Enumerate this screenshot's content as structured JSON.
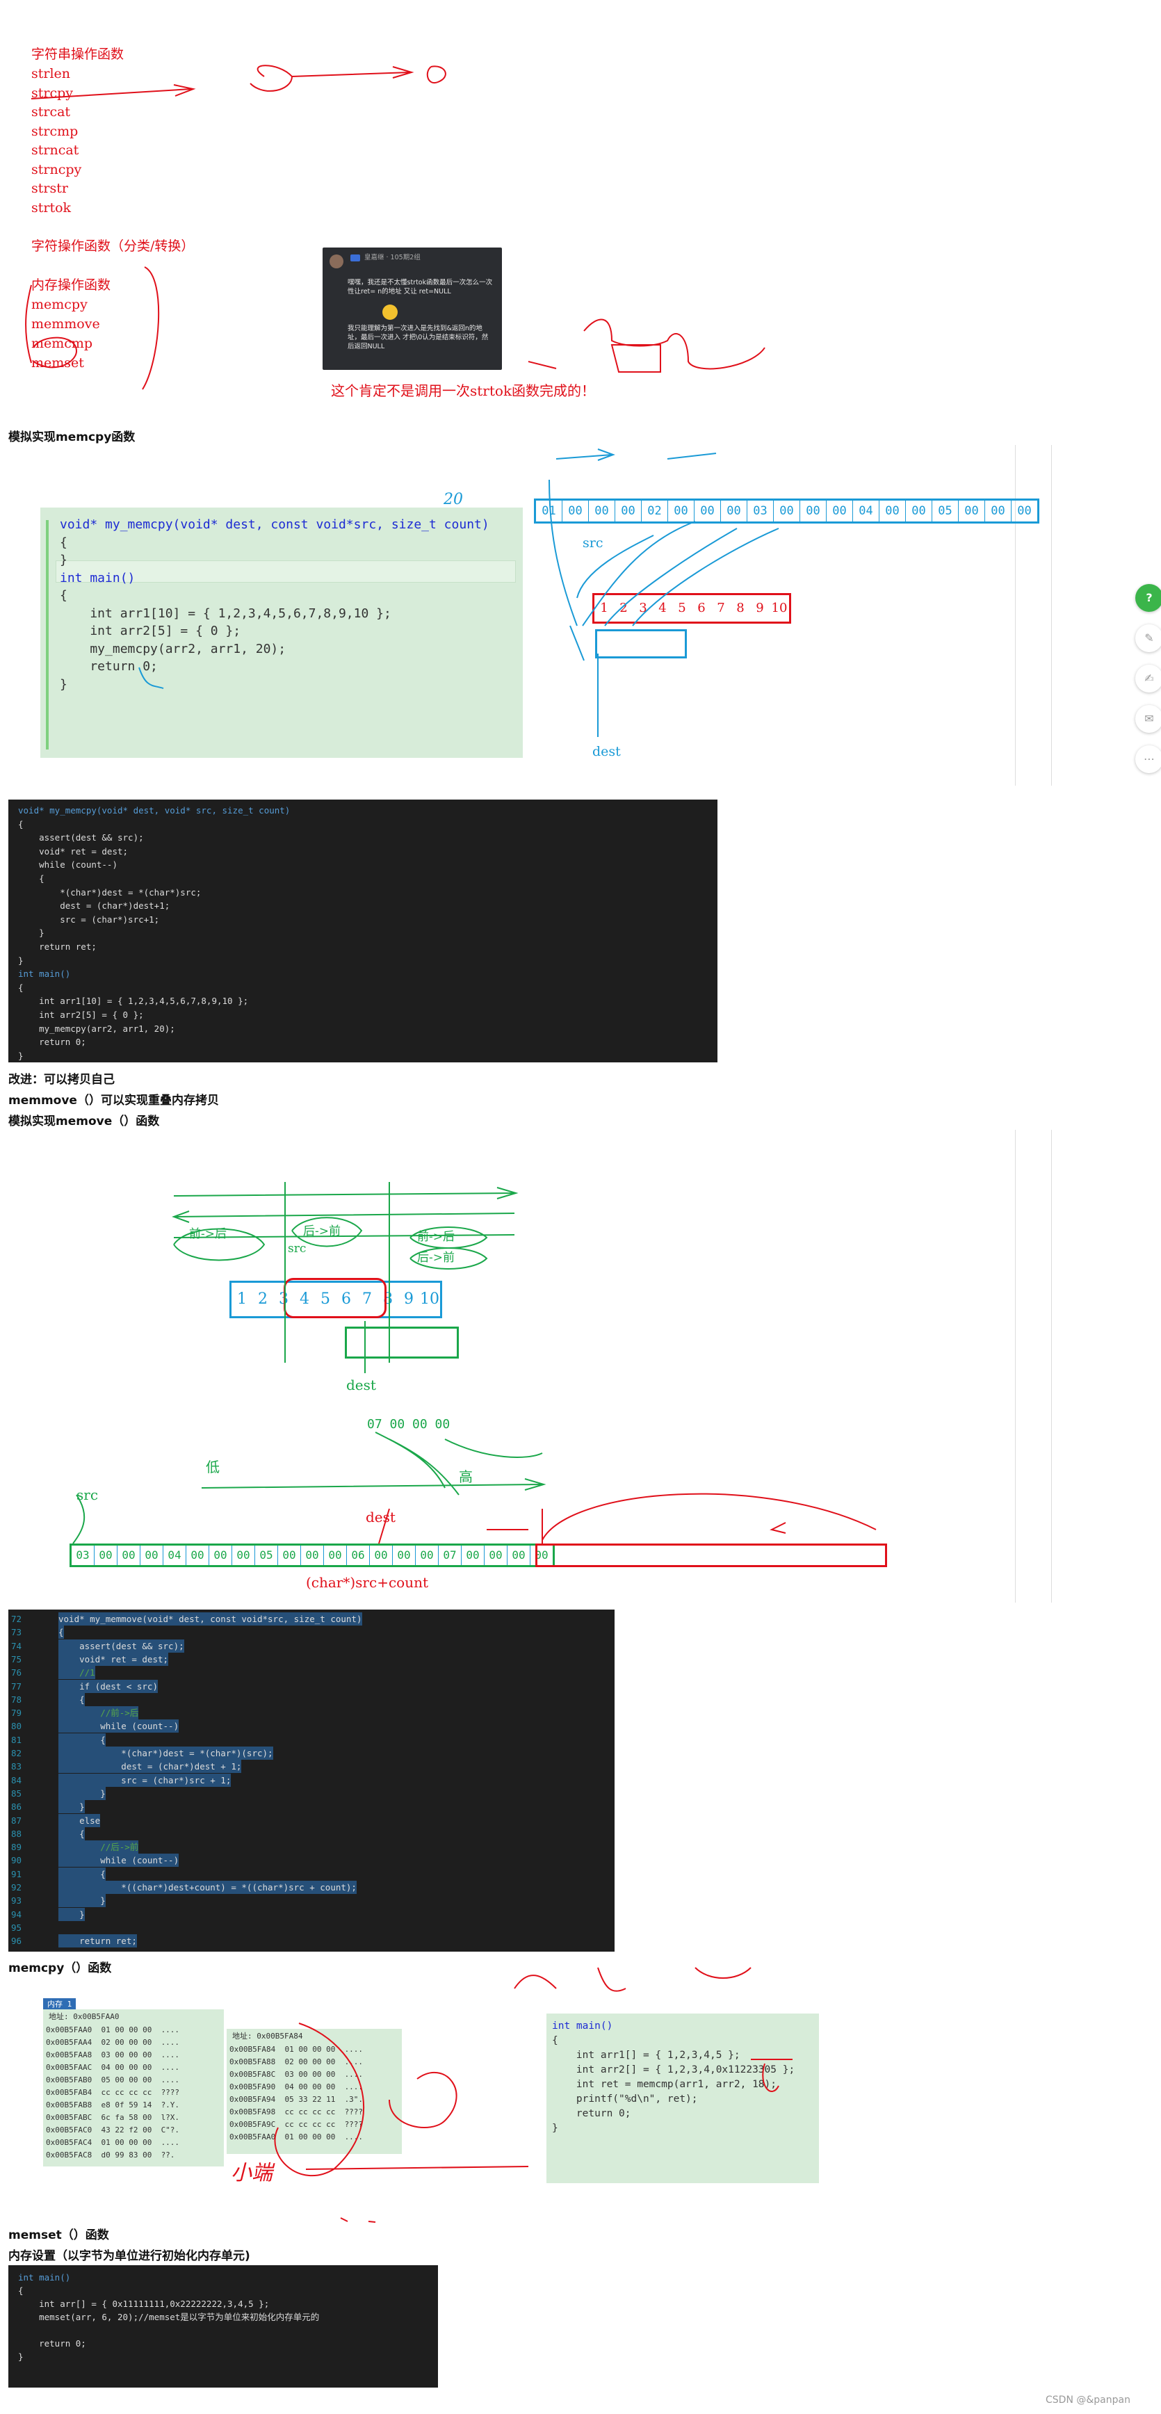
{
  "top_list": {
    "title1": "字符串操作函数",
    "items1": [
      "strlen",
      "strcpy",
      "strcat",
      "strcmp",
      "strncat",
      "strncpy",
      "strstr",
      "strtok"
    ],
    "title2": "字符操作函数（分类/转换）",
    "title3": "内存操作函数",
    "items3": [
      "memcpy",
      "memmove",
      "memcmp",
      "memset"
    ]
  },
  "comment_card": {
    "user": "皇嘉继 · 105期2组",
    "text": "嘿嘿，我还是不太懂strtok函数最后一次怎么一次性让ret= n的地址 又让 ret=NULL",
    "text2": "我只能理解为第一次进入是先找到&返回n的地址，最后一次进入 才把\\0认为是结束标识符，然后返回NULL"
  },
  "annotation_strtok": "这个肯定不是调用一次strtok函数完成的！",
  "headings": {
    "h1": "模拟实现memcpy函数",
    "h2": "改进：可以拷贝自己",
    "h3": "memmove（）可以实现重叠内存拷贝",
    "h4": "模拟实现memove（）函数",
    "h5": "memcpy（）函数",
    "h6": "memset（）函数",
    "h7": "内存设置（以字节为单位进行初始化内存单元)"
  },
  "code1": [
    "void* my_memcpy(void* dest, const void*src, size_t count)",
    "{",
    "",
    "}",
    "",
    "int main()",
    "{",
    "    int arr1[10] = { 1,2,3,4,5,6,7,8,9,10 };",
    "    int arr2[5] = { 0 };",
    "    my_memcpy(arr2, arr1, 20);",
    "",
    "    return 0;",
    "}"
  ],
  "diagram1": {
    "bytes": [
      "01",
      "00",
      "00",
      "00",
      "02",
      "00",
      "00",
      "00",
      "03",
      "00",
      "00",
      "00",
      "04",
      "00",
      "00",
      "05",
      "00",
      "00",
      "00"
    ],
    "array": [
      "1",
      "2",
      "3",
      "4",
      "5",
      "6",
      "7",
      "8",
      "9",
      "10"
    ],
    "label_src": "src",
    "label_dest": "dest",
    "label_20": "20"
  },
  "code2": [
    "void* my_memcpy(void* dest, void* src, size_t count)",
    "{",
    "    assert(dest && src);",
    "    void* ret = dest;",
    "    while (count--)",
    "    {",
    "        *(char*)dest = *(char*)src;",
    "        dest = (char*)dest+1;",
    "        src = (char*)src+1;",
    "    }",
    "    return ret;",
    "}",
    "int main()",
    "{",
    "    int arr1[10] = { 1,2,3,4,5,6,7,8,9,10 };",
    "    int arr2[5] = { 0 };",
    "    my_memcpy(arr2, arr1, 20);",
    "    return 0;",
    "}"
  ],
  "diagram2": {
    "array": [
      "1",
      "2",
      "3",
      "4",
      "5",
      "6",
      "7",
      "8",
      "9",
      "10"
    ],
    "labels": [
      "前->后",
      "后->前",
      "前->后",
      "后->前",
      "src",
      "dest",
      "低",
      "高",
      "src",
      "dest",
      "(char*)src+count"
    ],
    "small_bytes": "07 00 00 00",
    "bytes": [
      "03",
      "00",
      "00",
      "00",
      "04",
      "00",
      "00",
      "00",
      "05",
      "00",
      "00",
      "00",
      "06",
      "00",
      "00",
      "00",
      "07",
      "00",
      "00",
      "00",
      "00"
    ]
  },
  "code3": {
    "line_numbers": [
      "72",
      "73",
      "74",
      "75",
      "76",
      "77",
      "78",
      "79",
      "80",
      "81",
      "82",
      "83",
      "84",
      "85",
      "86",
      "87",
      "88",
      "89",
      "90",
      "91",
      "92",
      "93",
      "94",
      "95",
      "96"
    ],
    "lines": [
      "void* my_memmove(void* dest, const void*src, size_t count)",
      "{",
      "    assert(dest && src);",
      "    void* ret = dest;",
      "    //1",
      "    if (dest < src)",
      "    {",
      "        //前->后",
      "        while (count--)",
      "        {",
      "            *(char*)dest = *(char*)(src);",
      "            dest = (char*)dest + 1;",
      "            src = (char*)src + 1;",
      "        }",
      "    }",
      "    else",
      "    {",
      "        //后->前",
      "        while (count--)",
      "        {",
      "            *((char*)dest+count) = *((char*)src + count);",
      "        }",
      "    }",
      "",
      "    return ret;"
    ]
  },
  "memwin1": {
    "title": "内存 1",
    "addr_label": "地址: 0x00B5FAA0",
    "rows": [
      [
        "0x00B5FAA0",
        "01 00 00 00",
        "...."
      ],
      [
        "0x00B5FAA4",
        "02 00 00 00",
        "...."
      ],
      [
        "0x00B5FAA8",
        "03 00 00 00",
        "...."
      ],
      [
        "0x00B5FAAC",
        "04 00 00 00",
        "...."
      ],
      [
        "0x00B5FAB0",
        "05 00 00 00",
        "...."
      ],
      [
        "0x00B5FAB4",
        "cc cc cc cc",
        "????"
      ],
      [
        "0x00B5FAB8",
        "e8 0f 59 14",
        "?.Y."
      ],
      [
        "0x00B5FABC",
        "6c fa 58 00",
        "l?X."
      ],
      [
        "0x00B5FAC0",
        "43 22 f2 00",
        "C\"?."
      ],
      [
        "0x00B5FAC4",
        "01 00 00 00",
        "...."
      ],
      [
        "0x00B5FAC8",
        "d0 99 83 00",
        "??."
      ]
    ]
  },
  "memwin2": {
    "addr_label": "地址: 0x00B5FA84",
    "rows": [
      [
        "0x00B5FA84",
        "01 00 00 00",
        "...."
      ],
      [
        "0x00B5FA88",
        "02 00 00 00",
        "...."
      ],
      [
        "0x00B5FA8C",
        "03 00 00 00",
        "...."
      ],
      [
        "0x00B5FA90",
        "04 00 00 00",
        "...."
      ],
      [
        "0x00B5FA94",
        "05 33 22 11",
        ".3\"."
      ],
      [
        "0x00B5FA98",
        "cc cc cc cc",
        "????"
      ],
      [
        "0x00B5FA9C",
        "cc cc cc cc",
        "????"
      ],
      [
        "0x00B5FAA0",
        "01 00 00 00",
        "...."
      ]
    ]
  },
  "code4": [
    "int main()",
    "{",
    "    int arr1[] = { 1,2,3,4,5 };",
    "    int arr2[] = { 1,2,3,4,0x11223305 };",
    "    int ret = memcmp(arr1, arr2, 18);",
    "    printf(\"%d\\n\", ret);",
    "",
    "    return 0;",
    "}"
  ],
  "code5": [
    "int main()",
    "{",
    "    int arr[] = { 0x11111111,0x22222222,3,4,5 };",
    "    memset(arr, 6, 20);//memset是以字节为单位来初始化内存单元的",
    "",
    "    return 0;",
    "}"
  ],
  "handwritten_small": "小端",
  "watermark": "CSDN @&panpan",
  "side_icons": [
    "help-icon",
    "comment-icon",
    "edit-icon",
    "mail-icon",
    "more-icon"
  ]
}
